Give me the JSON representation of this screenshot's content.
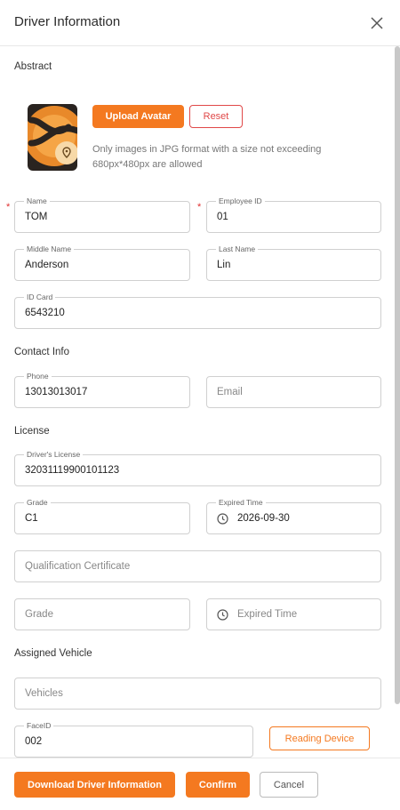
{
  "dialog": {
    "title": "Driver Information"
  },
  "sections": {
    "abstract": "Abstract",
    "contact": "Contact Info",
    "license": "License",
    "vehicle": "Assigned Vehicle"
  },
  "avatar": {
    "upload_label": "Upload Avatar",
    "reset_label": "Reset",
    "hint_line1": "Only images in JPG format with a size not exceeding",
    "hint_line2": "680px*480px are allowed",
    "colors": {
      "primary": "#f47920",
      "reset": "#e04848"
    }
  },
  "fields": {
    "name": {
      "label": "Name",
      "value": "TOM"
    },
    "employee_id": {
      "label": "Employee ID",
      "value": "01"
    },
    "middle_name": {
      "label": "Middle Name",
      "value": "Anderson"
    },
    "last_name": {
      "label": "Last Name",
      "value": "Lin"
    },
    "id_card": {
      "label": "ID Card",
      "value": "6543210"
    },
    "phone": {
      "label": "Phone",
      "value": "13013013017"
    },
    "email": {
      "placeholder": "Email"
    },
    "drivers_license": {
      "label": "Driver's License",
      "value": "32031119900101123"
    },
    "grade": {
      "label": "Grade",
      "value": "C1"
    },
    "expired_time": {
      "label": "Expired Time",
      "value": "2026-09-30"
    },
    "qualification_certificate": {
      "placeholder": "Qualification Certificate"
    },
    "cert_grade": {
      "placeholder": "Grade"
    },
    "cert_expired_time": {
      "placeholder": "Expired Time"
    },
    "vehicles": {
      "placeholder": "Vehicles"
    },
    "face_id": {
      "label": "FaceID",
      "value": "002"
    }
  },
  "required_mark": "*",
  "reading_device_label": "Reading Device",
  "footer": {
    "download_label": "Download Driver Information",
    "confirm_label": "Confirm",
    "cancel_label": "Cancel"
  },
  "icons": {
    "close": "close-icon",
    "clock": "clock-icon",
    "avatar": "avatar-image"
  }
}
